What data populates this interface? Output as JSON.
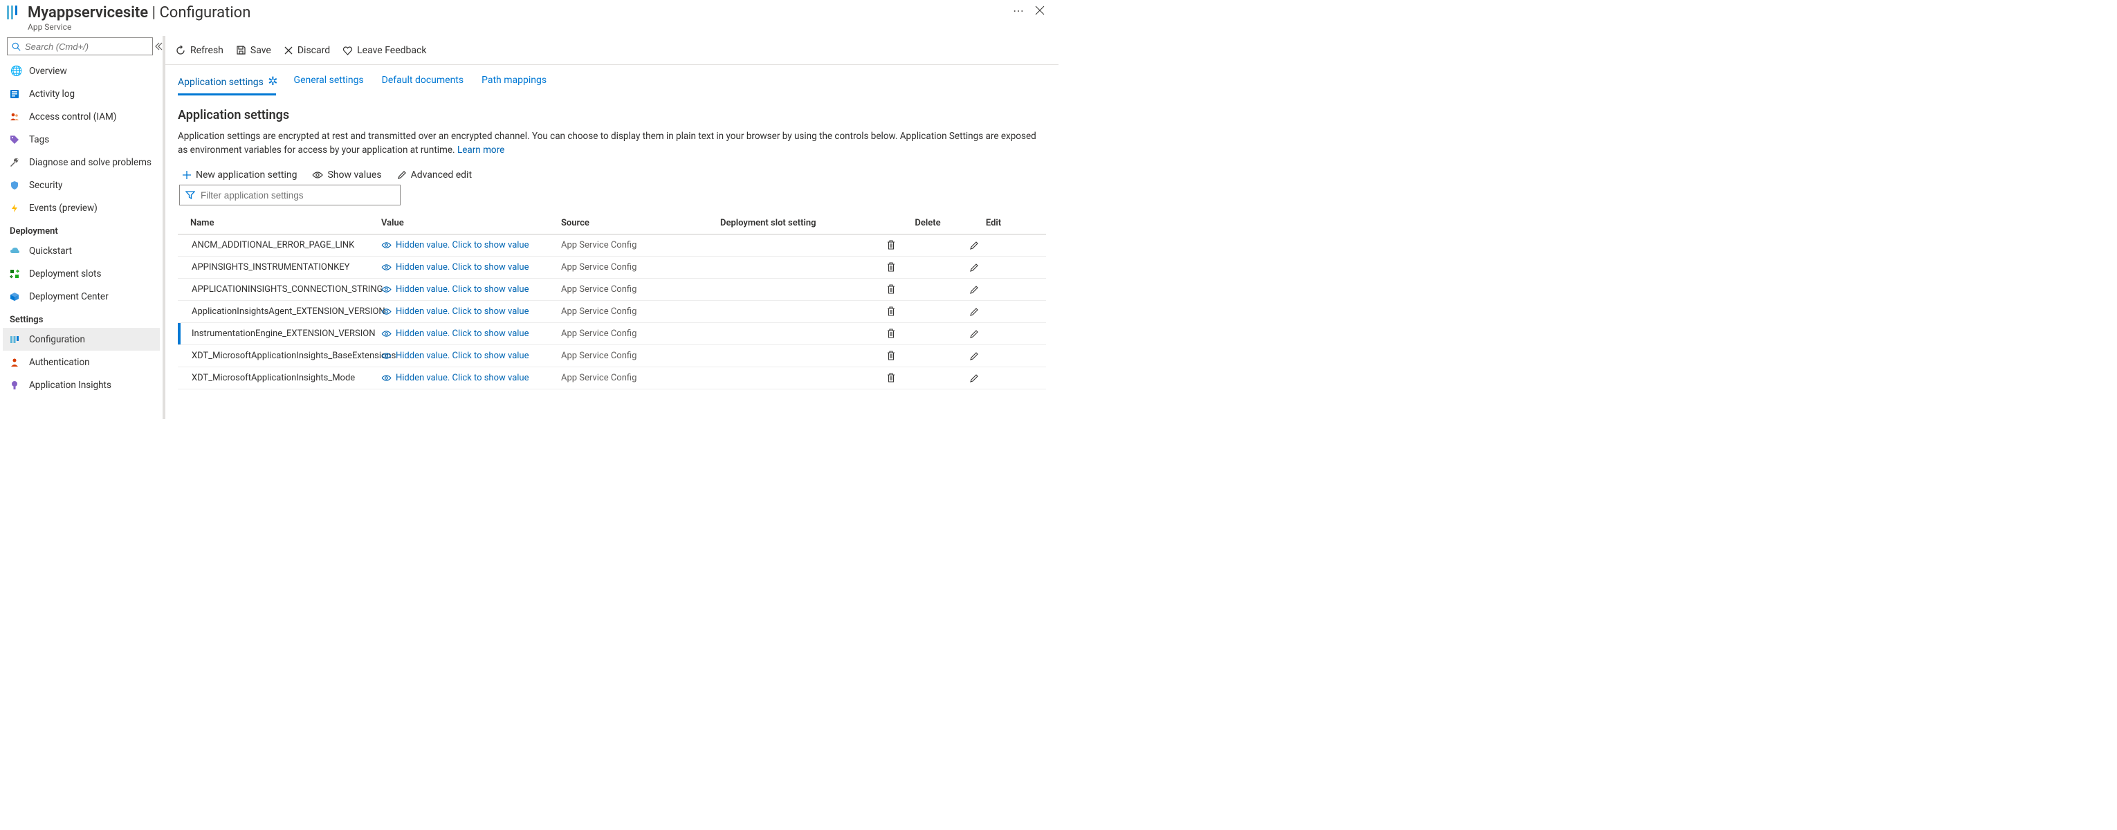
{
  "header": {
    "site_name": "Myappservicesite",
    "page_name": "Configuration",
    "resource_type": "App Service"
  },
  "sidebar": {
    "search_placeholder": "Search (Cmd+/)",
    "items_top": [
      {
        "icon": "globe-icon",
        "label": "Overview"
      },
      {
        "icon": "log-icon",
        "label": "Activity log"
      },
      {
        "icon": "people-icon",
        "label": "Access control (IAM)"
      },
      {
        "icon": "tag-icon",
        "label": "Tags"
      },
      {
        "icon": "wrench-icon",
        "label": "Diagnose and solve problems"
      },
      {
        "icon": "shield-icon",
        "label": "Security"
      },
      {
        "icon": "bolt-icon",
        "label": "Events (preview)"
      }
    ],
    "section_deploy": "Deployment",
    "items_deploy": [
      {
        "icon": "cloud-icon",
        "label": "Quickstart"
      },
      {
        "icon": "slots-icon",
        "label": "Deployment slots"
      },
      {
        "icon": "box-icon",
        "label": "Deployment Center"
      }
    ],
    "section_settings": "Settings",
    "items_settings": [
      {
        "icon": "config-icon",
        "label": "Configuration",
        "active": true
      },
      {
        "icon": "auth-icon",
        "label": "Authentication"
      },
      {
        "icon": "insights-icon",
        "label": "Application Insights"
      }
    ]
  },
  "toolbar": {
    "refresh": "Refresh",
    "save": "Save",
    "discard": "Discard",
    "feedback": "Leave Feedback"
  },
  "tabs": {
    "application_settings": "Application settings",
    "general_settings": "General settings",
    "default_documents": "Default documents",
    "path_mappings": "Path mappings"
  },
  "settings_section": {
    "heading": "Application settings",
    "description_pre": "Application settings are encrypted at rest and transmitted over an encrypted channel. You can choose to display them in plain text in your browser by using the controls below. Application Settings are exposed as environment variables for access by your application at runtime. ",
    "learn_more": "Learn more",
    "new_setting": "New application setting",
    "show_values": "Show values",
    "advanced_edit": "Advanced edit",
    "filter_placeholder": "Filter application settings"
  },
  "grid": {
    "headers": {
      "name": "Name",
      "value": "Value",
      "source": "Source",
      "slot": "Deployment slot setting",
      "delete": "Delete",
      "edit": "Edit"
    },
    "hidden_display": "Hidden value. Click to show value",
    "rows": [
      {
        "name": "ANCM_ADDITIONAL_ERROR_PAGE_LINK",
        "source": "App Service Config"
      },
      {
        "name": "APPINSIGHTS_INSTRUMENTATIONKEY",
        "source": "App Service Config"
      },
      {
        "name": "APPLICATIONINSIGHTS_CONNECTION_STRING",
        "source": "App Service Config"
      },
      {
        "name": "ApplicationInsightsAgent_EXTENSION_VERSION",
        "source": "App Service Config"
      },
      {
        "name": "InstrumentationEngine_EXTENSION_VERSION",
        "source": "App Service Config",
        "modified": true
      },
      {
        "name": "XDT_MicrosoftApplicationInsights_BaseExtensions",
        "source": "App Service Config"
      },
      {
        "name": "XDT_MicrosoftApplicationInsights_Mode",
        "source": "App Service Config"
      }
    ]
  }
}
